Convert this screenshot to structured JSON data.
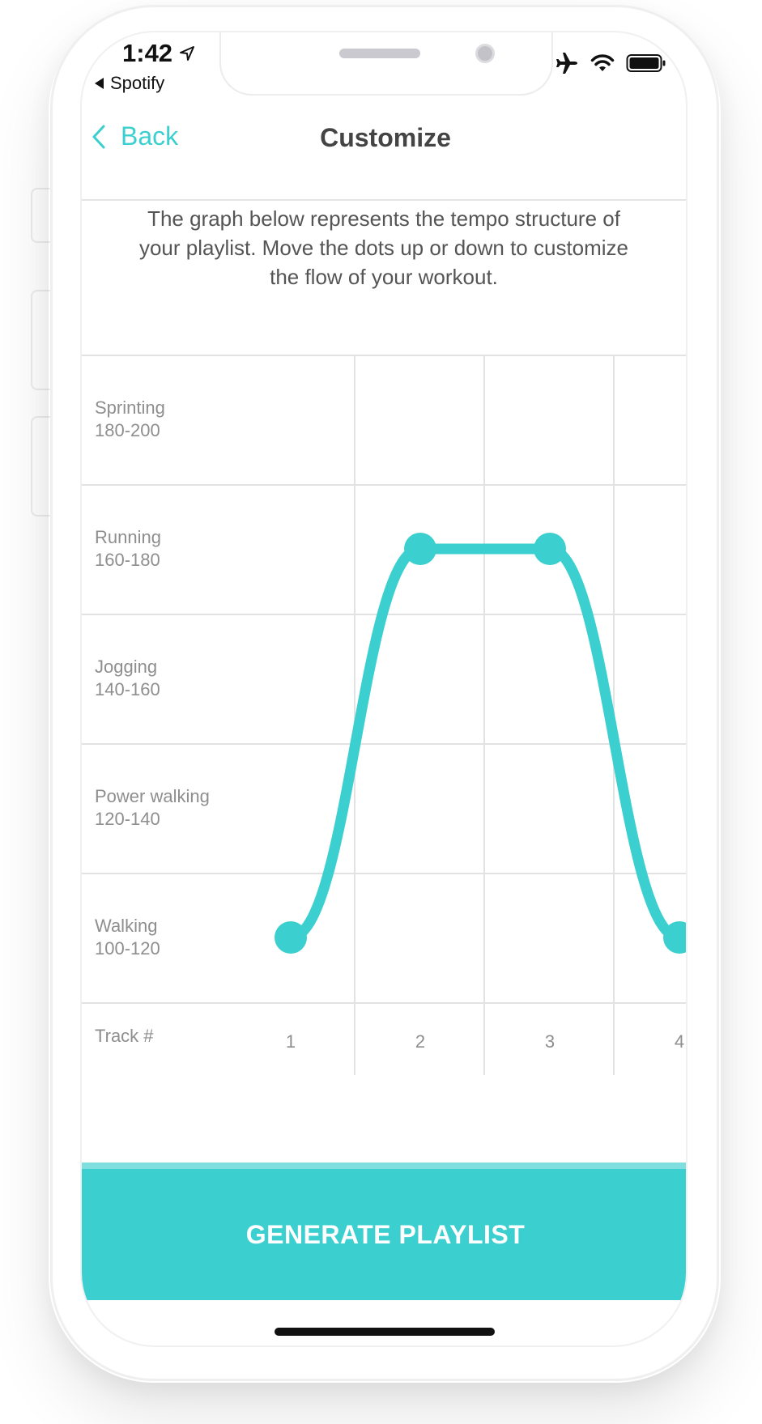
{
  "status_bar": {
    "time": "1:42",
    "back_app": "Spotify"
  },
  "nav": {
    "back_label": "Back",
    "title": "Customize"
  },
  "intro": {
    "text": "The graph below represents the tempo structure of your playlist. Move the dots up or down to customize the flow of your workout."
  },
  "graph": {
    "rows": [
      {
        "name": "Sprinting",
        "range": "180-200"
      },
      {
        "name": "Running",
        "range": "160-180"
      },
      {
        "name": "Jogging",
        "range": "140-160"
      },
      {
        "name": "Power walking",
        "range": "120-140"
      },
      {
        "name": "Walking",
        "range": "100-120"
      }
    ],
    "track_header": "Track #",
    "tracks": [
      "1",
      "2",
      "3",
      "4"
    ],
    "points": [
      {
        "track": "1",
        "level": "Walking"
      },
      {
        "track": "2",
        "level": "Running"
      },
      {
        "track": "3",
        "level": "Running"
      },
      {
        "track": "4",
        "level": "Walking"
      }
    ],
    "line_color": "#3ccfcf"
  },
  "cta": {
    "label": "GENERATE PLAYLIST"
  },
  "colors": {
    "accent": "#3ccfcf",
    "accent_light": "#7fdfdf"
  }
}
